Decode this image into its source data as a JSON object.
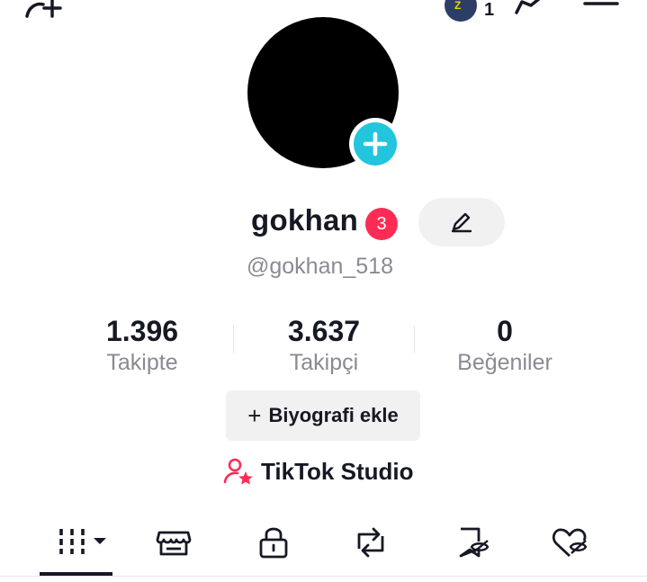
{
  "top_bar": {
    "avatar_count": "1",
    "avatar_letter": "Z",
    "icons": [
      "add-friend-icon",
      "share-icon",
      "menu-icon"
    ]
  },
  "profile": {
    "display_name": "gokhan",
    "badge_count": "3",
    "username": "@gokhan_518"
  },
  "stats": [
    {
      "value": "1.396",
      "label": "Takipte"
    },
    {
      "value": "3.637",
      "label": "Takipçi"
    },
    {
      "value": "0",
      "label": "Beğeniler"
    }
  ],
  "actions": {
    "bio_plus": "+",
    "bio_label": "Biyografi ekle",
    "studio_label": "TikTok Studio"
  },
  "tabs": [
    {
      "name": "videos-grid",
      "icon": "grid-icon",
      "active": true
    },
    {
      "name": "shop",
      "icon": "shop-icon"
    },
    {
      "name": "private",
      "icon": "lock-icon"
    },
    {
      "name": "reposts",
      "icon": "repost-icon"
    },
    {
      "name": "favorites",
      "icon": "bookmark-hidden-icon"
    },
    {
      "name": "liked",
      "icon": "heart-hidden-icon"
    }
  ],
  "colors": {
    "accent": "#fe2c55",
    "avatar_add": "#22c5dd",
    "text": "#161823",
    "muted": "#8a8b91",
    "chip_bg": "#f1f1f2"
  }
}
